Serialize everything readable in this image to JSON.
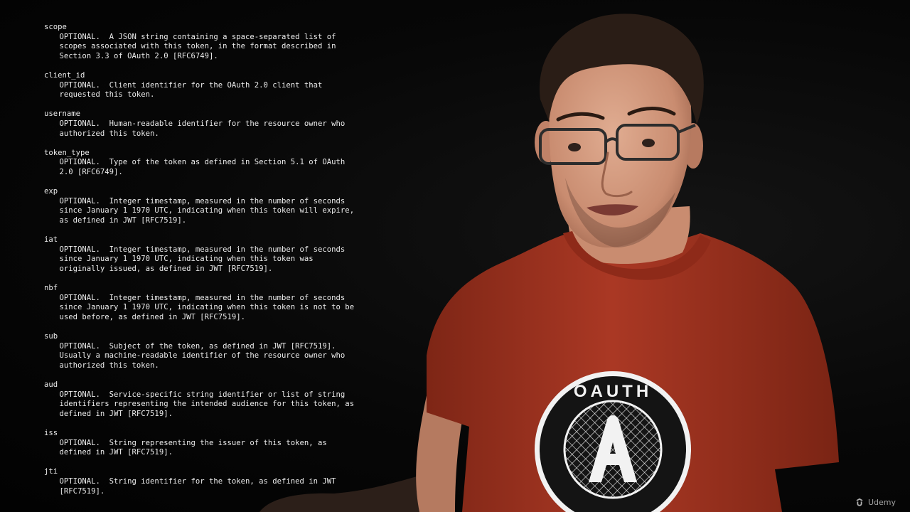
{
  "spec_entries": [
    {
      "term": "scope",
      "lines": [
        "OPTIONAL.  A JSON string containing a space-separated list of",
        "scopes associated with this token, in the format described in",
        "Section 3.3 of OAuth 2.0 [RFC6749]."
      ]
    },
    {
      "term": "client_id",
      "lines": [
        "OPTIONAL.  Client identifier for the OAuth 2.0 client that",
        "requested this token."
      ]
    },
    {
      "term": "username",
      "lines": [
        "OPTIONAL.  Human-readable identifier for the resource owner who",
        "authorized this token."
      ]
    },
    {
      "term": "token_type",
      "lines": [
        "OPTIONAL.  Type of the token as defined in Section 5.1 of OAuth",
        "2.0 [RFC6749]."
      ]
    },
    {
      "term": "exp",
      "lines": [
        "OPTIONAL.  Integer timestamp, measured in the number of seconds",
        "since January 1 1970 UTC, indicating when this token will expire,",
        "as defined in JWT [RFC7519]."
      ]
    },
    {
      "term": "iat",
      "lines": [
        "OPTIONAL.  Integer timestamp, measured in the number of seconds",
        "since January 1 1970 UTC, indicating when this token was",
        "originally issued, as defined in JWT [RFC7519]."
      ]
    },
    {
      "term": "nbf",
      "lines": [
        "OPTIONAL.  Integer timestamp, measured in the number of seconds",
        "since January 1 1970 UTC, indicating when this token is not to be",
        "used before, as defined in JWT [RFC7519]."
      ]
    },
    {
      "term": "sub",
      "lines": [
        "OPTIONAL.  Subject of the token, as defined in JWT [RFC7519].",
        "Usually a machine-readable identifier of the resource owner who",
        "authorized this token."
      ]
    },
    {
      "term": "aud",
      "lines": [
        "OPTIONAL.  Service-specific string identifier or list of string",
        "identifiers representing the intended audience for this token, as",
        "defined in JWT [RFC7519]."
      ]
    },
    {
      "term": "iss",
      "lines": [
        "OPTIONAL.  String representing the issuer of this token, as",
        "defined in JWT [RFC7519]."
      ]
    },
    {
      "term": "jti",
      "lines": [
        "OPTIONAL.  String identifier for the token, as defined in JWT",
        "[RFC7519]."
      ]
    }
  ],
  "shirt_logo": {
    "top_text": "OAUTH",
    "bottom_text": "OAUTH",
    "letter": "A"
  },
  "watermark": {
    "brand": "Udemy",
    "icon": "udemy-logo-icon"
  },
  "colors": {
    "shirt": "#a33421",
    "background": "#050505",
    "text": "#ececec",
    "skin": "#d19b80",
    "hair": "#2a1d16"
  }
}
